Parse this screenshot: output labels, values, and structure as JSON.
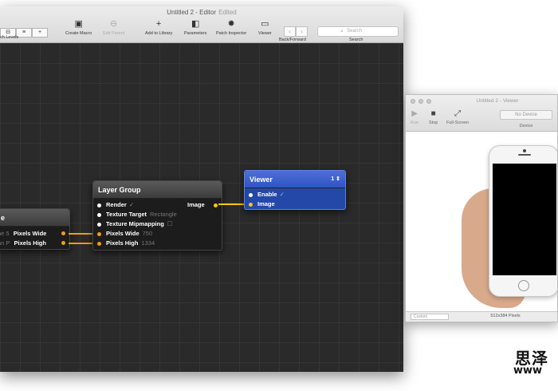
{
  "editor": {
    "title": "Untitled 2 - Editor",
    "edited": "Edited",
    "toolbar": {
      "levels_label": "ch Levels",
      "levels_seg": [
        "⊟",
        "≡",
        "+"
      ],
      "create_macro": "Create Macro",
      "edit_parent": "Edit Parent",
      "add_to_library": "Add to Library",
      "parameters": "Parameters",
      "patch_inspector": "Patch Inspector",
      "viewer": "Viewer",
      "back_forward": "Back/Forward",
      "search_placeholder": "Search",
      "search_label": "Search"
    }
  },
  "patches": {
    "partial": {
      "title": "e",
      "ports": [
        {
          "left_label": "ne 5",
          "label": "Pixels Wide"
        },
        {
          "left_label": "an P",
          "label": "Pixels High"
        }
      ]
    },
    "layer_group": {
      "title": "Layer Group",
      "output": "Image",
      "ports": [
        {
          "label": "Render",
          "value": "✓"
        },
        {
          "label": "Texture Target",
          "value": "Rectangle"
        },
        {
          "label": "Texture Mipmapping",
          "value": "☐"
        },
        {
          "label": "Pixels Wide",
          "value": "750"
        },
        {
          "label": "Pixels High",
          "value": "1334"
        }
      ]
    },
    "viewer": {
      "title": "Viewer",
      "badge": "1 ⇕",
      "ports": [
        {
          "label": "Enable",
          "value": "✓"
        },
        {
          "label": "Image",
          "value": ""
        }
      ]
    }
  },
  "viewer_window": {
    "title": "Untitled 2 - Viewer",
    "run": "Run",
    "stop": "Stop",
    "full_screen": "Full-Screen",
    "device_value": "No Device",
    "device_label": "Device",
    "zoom": "Custom",
    "pixels": "512x384 Pixels"
  },
  "watermark": {
    "line1": "思泽",
    "line2": "www"
  }
}
